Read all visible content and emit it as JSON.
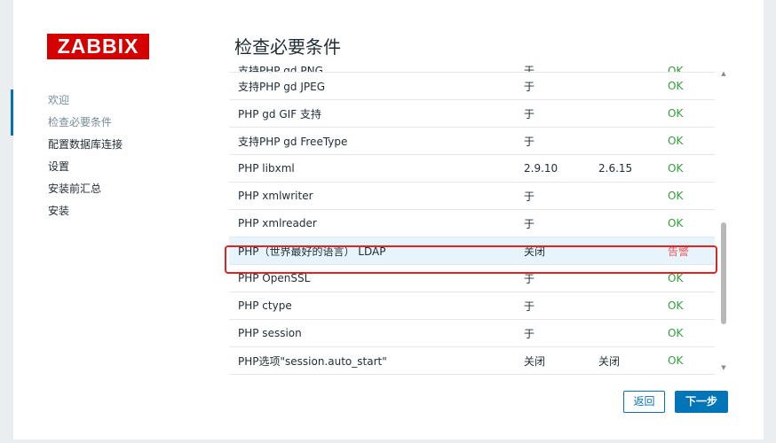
{
  "brand": {
    "logo_text": "ZABBIX",
    "accent": "#0275b8",
    "logo_color": "#d40000"
  },
  "sidebar": {
    "items": [
      {
        "label": "欢迎",
        "state": "done"
      },
      {
        "label": "检查必要条件",
        "state": "current"
      },
      {
        "label": "配置数据库连接",
        "state": "todo"
      },
      {
        "label": "设置",
        "state": "todo"
      },
      {
        "label": "安装前汇总",
        "state": "todo"
      },
      {
        "label": "安装",
        "state": "todo"
      }
    ]
  },
  "main": {
    "title": "检查必要条件",
    "rows": [
      {
        "name": "支持PHP gd PNG",
        "current": "于",
        "required": "",
        "status": "OK"
      },
      {
        "name": "支持PHP gd JPEG",
        "current": "于",
        "required": "",
        "status": "OK"
      },
      {
        "name": "PHP gd GIF 支持",
        "current": "于",
        "required": "",
        "status": "OK"
      },
      {
        "name": "支持PHP gd FreeType",
        "current": "于",
        "required": "",
        "status": "OK"
      },
      {
        "name": "PHP libxml",
        "current": "2.9.10",
        "required": "2.6.15",
        "status": "OK"
      },
      {
        "name": "PHP xmlwriter",
        "current": "于",
        "required": "",
        "status": "OK"
      },
      {
        "name": "PHP xmlreader",
        "current": "于",
        "required": "",
        "status": "OK"
      },
      {
        "name": "PHP（世界最好的语言） LDAP",
        "current": "关闭",
        "required": "",
        "status": "告警"
      },
      {
        "name": "PHP OpenSSL",
        "current": "于",
        "required": "",
        "status": "OK"
      },
      {
        "name": "PHP ctype",
        "current": "于",
        "required": "",
        "status": "OK"
      },
      {
        "name": "PHP session",
        "current": "于",
        "required": "",
        "status": "OK"
      },
      {
        "name": "PHP选项\"session.auto_start\"",
        "current": "关闭",
        "required": "关闭",
        "status": "OK"
      }
    ]
  },
  "buttons": {
    "back": "返回",
    "next": "下一步"
  },
  "icons": {
    "scroll_up": "triangle-up-icon",
    "scroll_down": "triangle-down-icon"
  },
  "colors": {
    "ok": "#2f9f38",
    "warn": "#e45959",
    "highlight_border": "#e02424"
  }
}
